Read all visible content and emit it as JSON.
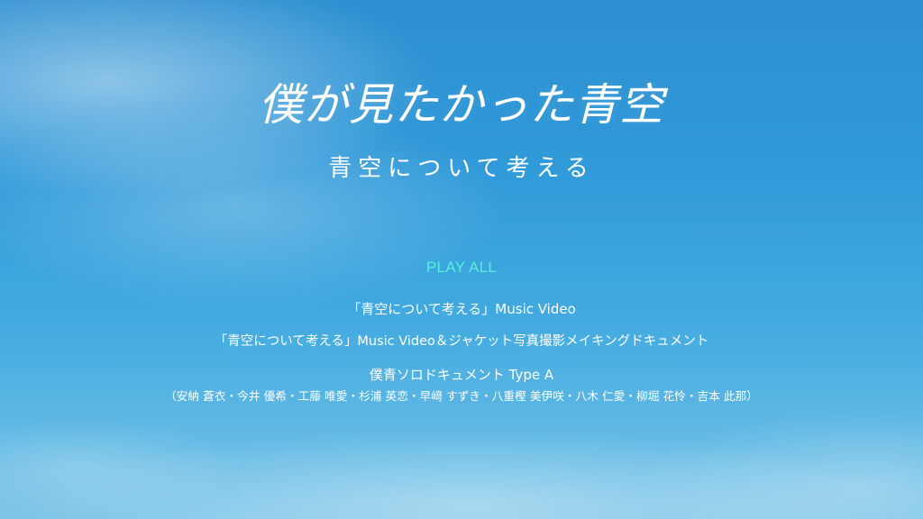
{
  "title": "僕が見たかった青空",
  "subtitle": "青空について考える",
  "menu": {
    "play_all": "PLAY ALL",
    "items": [
      {
        "label": "「青空について考える」Music Video"
      },
      {
        "label": "「青空について考える」Music Video＆ジャケット写真撮影メイキングドキュメント"
      },
      {
        "label": "僕青ソロドキュメント Type A",
        "members": "（安納 蒼衣・今井 優希・工藤 唯愛・杉浦 英恋・早﨑 すずき・八重樫 美伊咲・八木 仁愛・柳堀 花怜・吉本 此那）"
      }
    ]
  },
  "colors": {
    "selected": "#58efd8",
    "text": "#ffffff"
  }
}
